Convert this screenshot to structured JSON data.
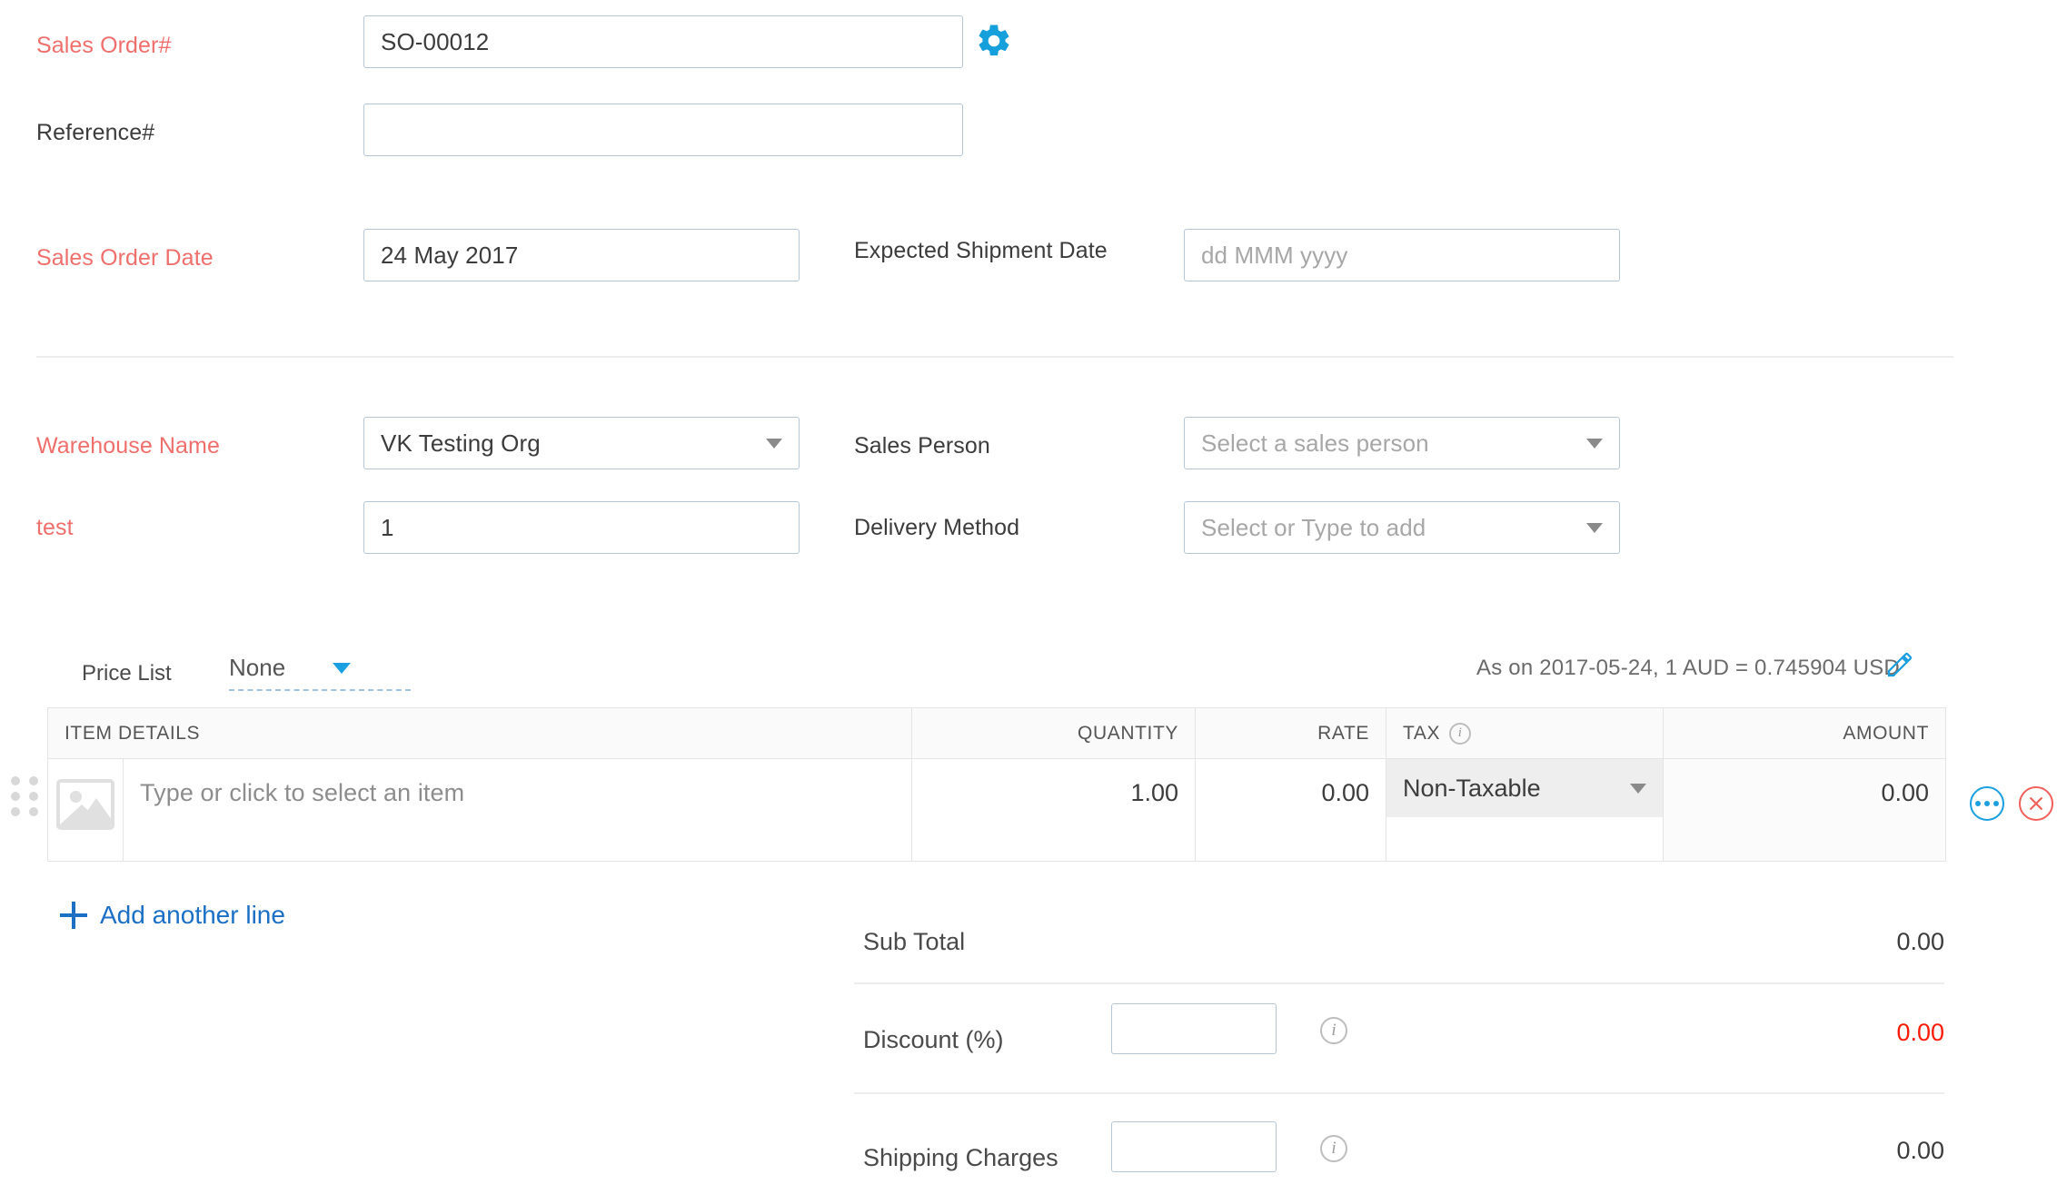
{
  "form": {
    "sales_order": {
      "label": "Sales Order#",
      "value": "SO-00012",
      "settings_icon": "gear-icon"
    },
    "reference": {
      "label": "Reference#",
      "value": "",
      "placeholder": ""
    },
    "sales_order_date": {
      "label": "Sales Order Date",
      "value": "24 May 2017"
    },
    "expected_shipment_date": {
      "label": "Expected Shipment Date",
      "value": "",
      "placeholder": "dd MMM yyyy"
    },
    "warehouse_name": {
      "label": "Warehouse Name",
      "value": "VK Testing Org"
    },
    "sales_person": {
      "label": "Sales Person",
      "value": "",
      "placeholder": "Select a sales person"
    },
    "test_field": {
      "label": "test",
      "value": "1"
    },
    "delivery_method": {
      "label": "Delivery Method",
      "value": "",
      "placeholder": "Select or Type to add"
    }
  },
  "price_list": {
    "label": "Price List",
    "value": "None"
  },
  "exchange_rate": {
    "text": "As on 2017-05-24, 1 AUD = 0.745904 USD",
    "edit_icon": "pencil-icon"
  },
  "items_table": {
    "headers": {
      "item_details": "ITEM DETAILS",
      "quantity": "QUANTITY",
      "rate": "RATE",
      "tax": "TAX",
      "amount": "AMOUNT"
    },
    "rows": [
      {
        "item_placeholder": "Type or click to select an item",
        "quantity": "1.00",
        "rate": "0.00",
        "tax": "Non-Taxable",
        "amount": "0.00"
      }
    ]
  },
  "add_line": {
    "label": "Add another line"
  },
  "totals": {
    "sub_total": {
      "label": "Sub Total",
      "value": "0.00"
    },
    "discount": {
      "label": "Discount (%)",
      "input_value": "",
      "value": "0.00"
    },
    "shipping_charges": {
      "label": "Shipping Charges",
      "input_value": "",
      "value": "0.00"
    }
  },
  "colors": {
    "required_label": "#ef6f6c",
    "link_blue": "#1b6fc4",
    "accent_blue": "#1a9fe0",
    "delete_red": "#f2605c",
    "discount_red": "#fb1b07",
    "input_border": "#b5c6d6"
  }
}
